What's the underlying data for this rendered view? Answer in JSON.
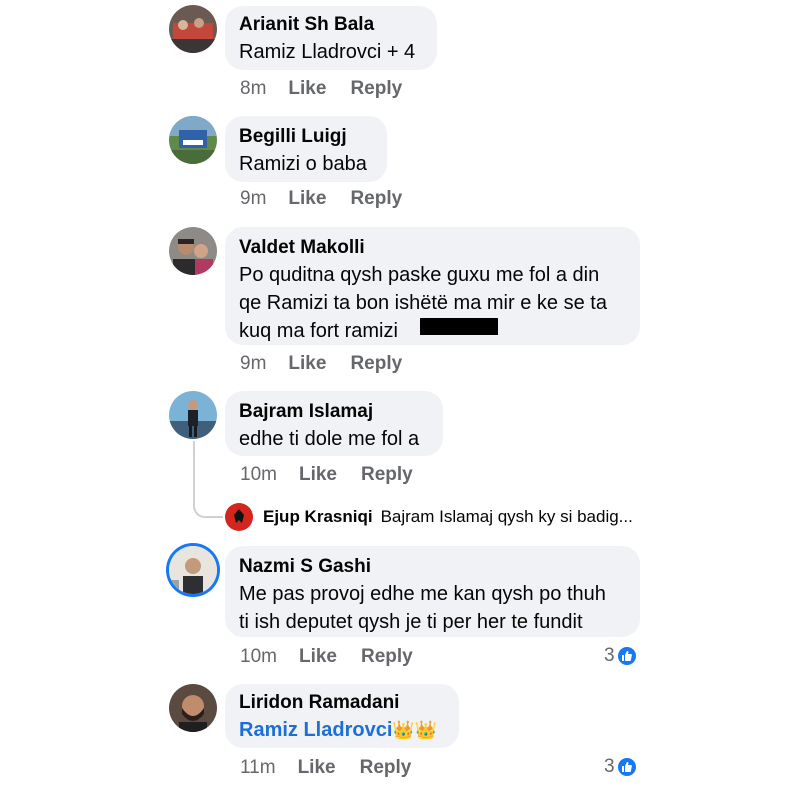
{
  "comments": [
    {
      "author": "Arianit Sh Bala",
      "text": "Ramiz Lladrovci + 4",
      "time": "8m",
      "like": "Like",
      "reply": "Reply"
    },
    {
      "author": "Begilli Luigj",
      "text": "Ramizi o baba",
      "time": "9m",
      "like": "Like",
      "reply": "Reply"
    },
    {
      "author": "Valdet Makolli",
      "line1": "Po quditna qysh paske guxu me fol a din",
      "line2": "qe Ramizi ta bon ishëtë ma mir e ke se ta",
      "line3": "kuq ma fort ramizi",
      "time": "9m",
      "like": "Like",
      "reply": "Reply"
    },
    {
      "author": "Bajram Islamaj",
      "text": "edhe ti dole me fol a",
      "time": "10m",
      "like": "Like",
      "reply": "Reply",
      "reply_preview": {
        "author": "Ejup Krasniqi",
        "text": "Bajram Islamaj qysh ky si badig..."
      }
    },
    {
      "author": "Nazmi S Gashi",
      "line1": "Me pas provoj edhe me kan qysh po thuh",
      "line2": "ti ish deputet qysh je ti per her te fundit",
      "time": "10m",
      "like": "Like",
      "reply": "Reply",
      "reactions": "3"
    },
    {
      "author": "Liridon Ramadani",
      "mention": "Ramiz Lladrovci",
      "emoji": "👑👑",
      "time": "11m",
      "like": "Like",
      "reply": "Reply",
      "reactions": "3"
    }
  ],
  "colors": {
    "bubble": "#f0f2f5",
    "mention": "#1b6fd8",
    "like_blue": "#1877f2",
    "meta": "#65676b"
  }
}
